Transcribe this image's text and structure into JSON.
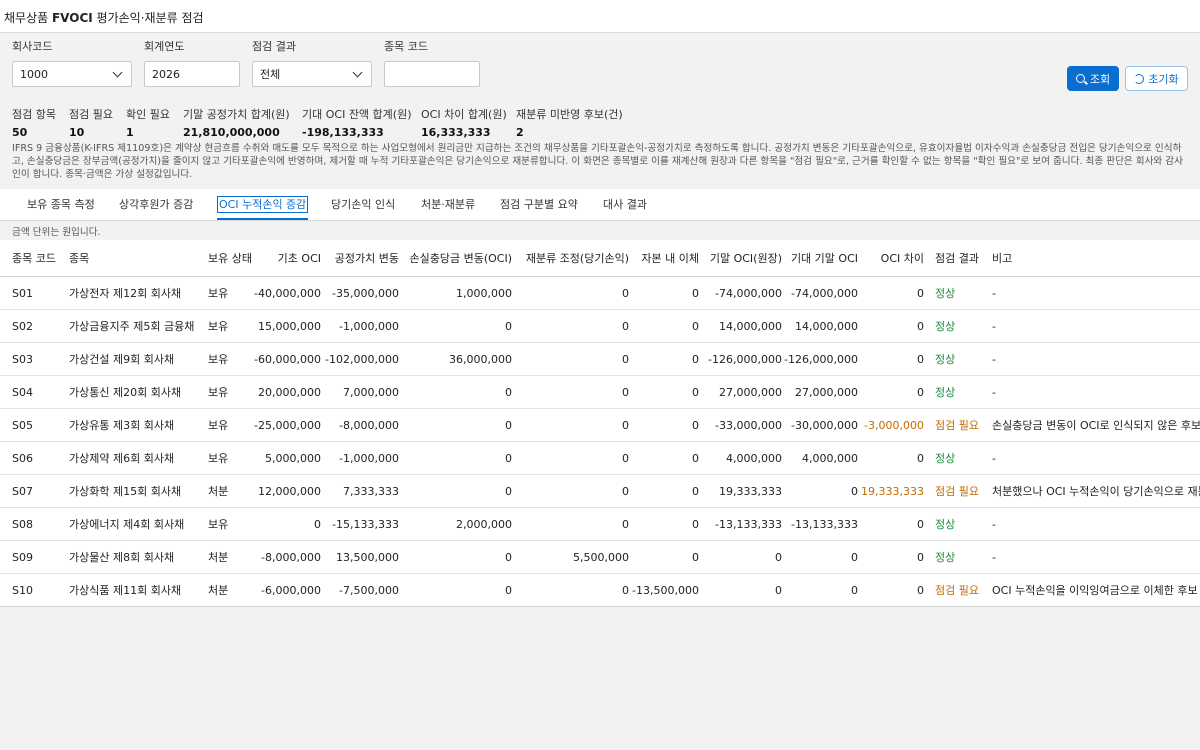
{
  "title": {
    "prefix": "채무상품 ",
    "bold": "FVOCI",
    "suffix": " 평가손익·재분류 점검"
  },
  "filters": {
    "company": {
      "label": "회사코드",
      "value": "1000"
    },
    "year": {
      "label": "회계연도",
      "value": "2026"
    },
    "result": {
      "label": "점검 결과",
      "value": "전체"
    },
    "item": {
      "label": "종목 코드",
      "value": ""
    }
  },
  "buttons": {
    "search": "조회",
    "reset": "초기화"
  },
  "summary": [
    {
      "label": "점검 항목",
      "value": "50"
    },
    {
      "label": "점검 필요",
      "value": "10"
    },
    {
      "label": "확인 필요",
      "value": "1"
    },
    {
      "label": "기말 공정가치 합계(원)",
      "value": "21,810,000,000"
    },
    {
      "label": "기대 OCI 잔액 합계(원)",
      "value": "-198,133,333"
    },
    {
      "label": "OCI 차이 합계(원)",
      "value": "16,333,333"
    },
    {
      "label": "재분류 미반영 후보(건)",
      "value": "2"
    }
  ],
  "description": "IFRS 9 금융상품(K-IFRS 제1109호)은 계약상 현금흐름 수취와 매도를 모두 목적으로 하는 사업모형에서 원리금만 지급하는 조건의 채무상품을 기타포괄손익-공정가치로 측정하도록 합니다. 공정가치 변동은 기타포괄손익으로, 유효이자율법 이자수익과 손실충당금 전입은 당기손익으로 인식하고, 손실충당금은 장부금액(공정가치)을 줄이지 않고 기타포괄손익에 반영하며, 제거할 때 누적 기타포괄손익은 당기손익으로 재분류합니다. 이 화면은 종목별로 이를 재계산해 원장과 다른 항목을 \"점검 필요\"로, 근거를 확인할 수 없는 항목을 \"확인 필요\"로 보여 줍니다. 최종 판단은 회사와 감사인이 합니다. 종목·금액은 가상 설정값입니다.",
  "tabs": [
    "보유 종목 측정",
    "상각후원가 증감",
    "OCI 누적손익 증감",
    "당기손익 인식",
    "처분·재분류",
    "점검 구분별 요약",
    "대사 결과"
  ],
  "active_tab": "OCI 누적손익 증감",
  "unit_note": "금액 단위는 원입니다.",
  "columns": [
    "종목 코드",
    "종목",
    "보유 상태",
    "기초 OCI",
    "공정가치 변동",
    "손실충당금 변동(OCI)",
    "재분류 조정(당기손익)",
    "자본 내 이체",
    "기말 OCI(원장)",
    "기대 기말 OCI",
    "OCI 차이",
    "점검 결과",
    "비고"
  ],
  "rows": [
    {
      "code": "S01",
      "name": "가상전자 제12회 회사채",
      "status": "보유",
      "begin": "-40,000,000",
      "fv": "-35,000,000",
      "allow": "1,000,000",
      "reclass": "0",
      "transfer": "0",
      "end_ledger": "-74,000,000",
      "end_expected": "-74,000,000",
      "diff": "0",
      "result": "정상",
      "result_type": "ok",
      "note": "-"
    },
    {
      "code": "S02",
      "name": "가상금융지주 제5회 금융채",
      "status": "보유",
      "begin": "15,000,000",
      "fv": "-1,000,000",
      "allow": "0",
      "reclass": "0",
      "transfer": "0",
      "end_ledger": "14,000,000",
      "end_expected": "14,000,000",
      "diff": "0",
      "result": "정상",
      "result_type": "ok",
      "note": "-"
    },
    {
      "code": "S03",
      "name": "가상건설 제9회 회사채",
      "status": "보유",
      "begin": "-60,000,000",
      "fv": "-102,000,000",
      "allow": "36,000,000",
      "reclass": "0",
      "transfer": "0",
      "end_ledger": "-126,000,000",
      "end_expected": "-126,000,000",
      "diff": "0",
      "result": "정상",
      "result_type": "ok",
      "note": "-"
    },
    {
      "code": "S04",
      "name": "가상통신 제20회 회사채",
      "status": "보유",
      "begin": "20,000,000",
      "fv": "7,000,000",
      "allow": "0",
      "reclass": "0",
      "transfer": "0",
      "end_ledger": "27,000,000",
      "end_expected": "27,000,000",
      "diff": "0",
      "result": "정상",
      "result_type": "ok",
      "note": "-"
    },
    {
      "code": "S05",
      "name": "가상유통 제3회 회사채",
      "status": "보유",
      "begin": "-25,000,000",
      "fv": "-8,000,000",
      "allow": "0",
      "reclass": "0",
      "transfer": "0",
      "end_ledger": "-33,000,000",
      "end_expected": "-30,000,000",
      "diff": "-3,000,000",
      "result": "점검 필요",
      "result_type": "warn",
      "note": "손실충당금 변동이 OCI로 인식되지 않은 후보"
    },
    {
      "code": "S06",
      "name": "가상제약 제6회 회사채",
      "status": "보유",
      "begin": "5,000,000",
      "fv": "-1,000,000",
      "allow": "0",
      "reclass": "0",
      "transfer": "0",
      "end_ledger": "4,000,000",
      "end_expected": "4,000,000",
      "diff": "0",
      "result": "정상",
      "result_type": "ok",
      "note": "-"
    },
    {
      "code": "S07",
      "name": "가상화학 제15회 회사채",
      "status": "처분",
      "begin": "12,000,000",
      "fv": "7,333,333",
      "allow": "0",
      "reclass": "0",
      "transfer": "0",
      "end_ledger": "19,333,333",
      "end_expected": "0",
      "diff": "19,333,333",
      "result": "점검 필요",
      "result_type": "warn",
      "note": "처분했으나 OCI 누적손익이 당기손익으로 재분류되지 않은 후보"
    },
    {
      "code": "S08",
      "name": "가상에너지 제4회 회사채",
      "status": "보유",
      "begin": "0",
      "fv": "-15,133,333",
      "allow": "2,000,000",
      "reclass": "0",
      "transfer": "0",
      "end_ledger": "-13,133,333",
      "end_expected": "-13,133,333",
      "diff": "0",
      "result": "정상",
      "result_type": "ok",
      "note": "-"
    },
    {
      "code": "S09",
      "name": "가상물산 제8회 회사채",
      "status": "처분",
      "begin": "-8,000,000",
      "fv": "13,500,000",
      "allow": "0",
      "reclass": "5,500,000",
      "transfer": "0",
      "end_ledger": "0",
      "end_expected": "0",
      "diff": "0",
      "result": "정상",
      "result_type": "ok",
      "note": "-"
    },
    {
      "code": "S10",
      "name": "가상식품 제11회 회사채",
      "status": "처분",
      "begin": "-6,000,000",
      "fv": "-7,500,000",
      "allow": "0",
      "reclass": "0",
      "transfer": "-13,500,000",
      "end_ledger": "0",
      "end_expected": "0",
      "diff": "0",
      "result": "점검 필요",
      "result_type": "warn",
      "note": "OCI 누적손익을 이익잉여금으로 이체한 후보"
    }
  ],
  "colors": {
    "accent": "#0a6ed1",
    "ok": "#1e8a3c",
    "warn": "#c36b00"
  }
}
